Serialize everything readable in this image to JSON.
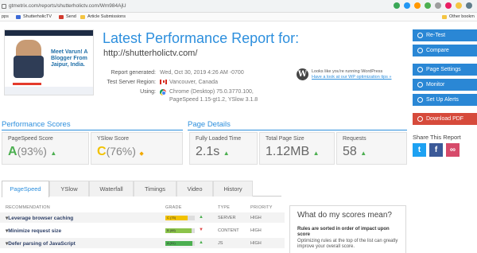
{
  "browser": {
    "url": "gtmetrix.com/reports/shutterholictv.com/Wm984AjU",
    "bookmarks": [
      "pps",
      "ShutterholicTV",
      "Send",
      "Article Submissions",
      "Other bookm"
    ]
  },
  "report": {
    "title": "Latest Performance Report for:",
    "site_url": "http://shutterholictv.com/",
    "thumb_text": "Meet Varun! A Blogger From Jaipur, India.",
    "meta": [
      {
        "label": "Report generated:",
        "value": "Wed, Oct 30, 2019 4:26 AM -0700"
      },
      {
        "label": "Test Server Region:",
        "value": "Vancouver, Canada"
      },
      {
        "label": "Using:",
        "value": "Chrome (Desktop) 75.0.3770.100,"
      },
      {
        "label": "",
        "value": "PageSpeed 1.15-gt1.2, YSlow 3.1.8"
      }
    ],
    "wp_notice": "Looks like you're running WordPress",
    "wp_link": "Have a look at our WP optimization tips »"
  },
  "performance_scores": {
    "title": "Performance Scores",
    "pagespeed": {
      "label": "PageSpeed Score",
      "grade": "A",
      "value": "(93%)"
    },
    "yslow": {
      "label": "YSlow Score",
      "grade": "C",
      "value": "(76%)"
    }
  },
  "page_details": {
    "title": "Page Details",
    "items": [
      {
        "label": "Fully Loaded Time",
        "value": "2.1s"
      },
      {
        "label": "Total Page Size",
        "value": "1.12MB"
      },
      {
        "label": "Requests",
        "value": "58"
      }
    ]
  },
  "sidebar": {
    "buttons": [
      "Re-Test",
      "Compare",
      "Page Settings",
      "Monitor",
      "Set Up Alerts",
      "Download PDF"
    ],
    "share_title": "Share This Report"
  },
  "tabs": [
    "PageSpeed",
    "YSlow",
    "Waterfall",
    "Timings",
    "Video",
    "History"
  ],
  "table": {
    "headers": [
      "RECOMMENDATION",
      "GRADE",
      "TYPE",
      "PRIORITY"
    ],
    "rows": [
      {
        "name": "Leverage browser caching",
        "grade": "C (75)",
        "score": 0.75,
        "type": "SERVER",
        "priority": "HIGH",
        "color": "#f2c200",
        "trend": "up"
      },
      {
        "name": "Minimize request size",
        "grade": "B (88)",
        "score": 0.88,
        "type": "CONTENT",
        "priority": "HIGH",
        "color": "#8bc34a",
        "trend": "down"
      },
      {
        "name": "Defer parsing of JavaScript",
        "grade": "A (91)",
        "score": 0.91,
        "type": "JS",
        "priority": "HIGH",
        "color": "#4caf50",
        "trend": "up"
      }
    ]
  },
  "info_box": {
    "heading": "What do my scores mean?",
    "bold": "Rules are sorted in order of impact upon score",
    "text": "Optimizing rules at the top of the list can greatly improve your overall score."
  },
  "colors": {
    "accent": "#2d8fdd",
    "button": "#2a87d5",
    "pdf": "#d64a3b",
    "grade_a": "#4caf50",
    "grade_c": "#f2c200"
  }
}
